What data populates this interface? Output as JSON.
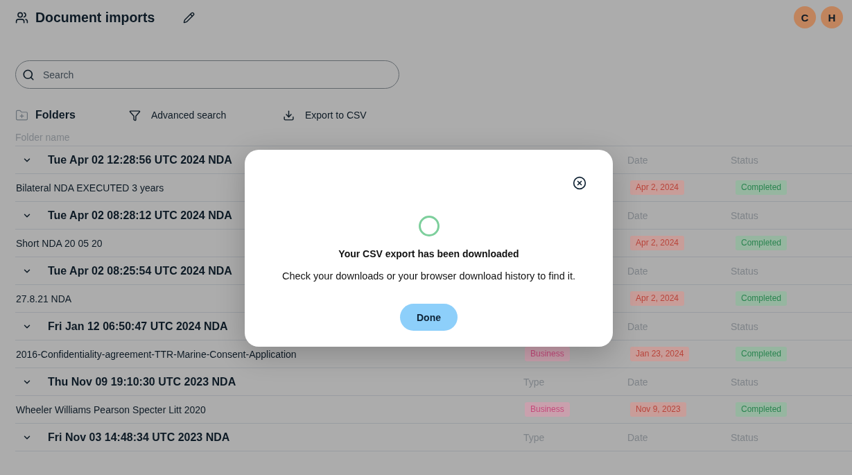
{
  "header": {
    "title": "Document imports",
    "avatars": [
      {
        "initial": "C"
      },
      {
        "initial": "H"
      }
    ]
  },
  "search": {
    "placeholder": "Search"
  },
  "toolbar": {
    "folders_label": "Folders",
    "actions": [
      {
        "kind": "filter",
        "label": "Advanced search"
      },
      {
        "kind": "export",
        "label": "Export to CSV"
      }
    ]
  },
  "list": {
    "column_header": "Folder name",
    "groups": [
      {
        "title": "Tue Apr 02 12:28:56 UTC 2024 NDA",
        "expanded": true,
        "column_labels": {
          "date": "Date",
          "status": "Status"
        },
        "items": [
          {
            "name": "Bilateral NDA EXECUTED 3 years",
            "date": "Apr 2, 2024",
            "status": "Completed"
          }
        ]
      },
      {
        "title": "Tue Apr 02 08:28:12 UTC 2024 NDA",
        "expanded": true,
        "column_labels": {
          "date": "Date",
          "status": "Status"
        },
        "items": [
          {
            "name": "Short NDA 20 05 20",
            "date": "Apr 2, 2024",
            "status": "Completed"
          }
        ]
      },
      {
        "title": "Tue Apr 02 08:25:54 UTC 2024 NDA",
        "expanded": true,
        "column_labels": {
          "date": "Date",
          "status": "Status"
        },
        "items": [
          {
            "name": "27.8.21 NDA",
            "date": "Apr 2, 2024",
            "status": "Completed"
          }
        ]
      },
      {
        "title": "Fri Jan 12 06:50:47 UTC 2024 NDA",
        "expanded": true,
        "column_labels": {
          "date": "Date",
          "status": "Status"
        },
        "items": [
          {
            "name": "2016-Confidentiality-agreement-TTR-Marine-Consent-Application",
            "type": "Business",
            "date": "Jan 23, 2024",
            "status": "Completed"
          }
        ]
      },
      {
        "title": "Thu Nov 09 19:10:30 UTC 2023 NDA",
        "expanded": true,
        "column_labels": {
          "type": "Type",
          "date": "Date",
          "status": "Status"
        },
        "items": [
          {
            "name": "Wheeler Williams Pearson Specter Litt 2020",
            "type": "Business",
            "date": "Nov 9, 2023",
            "status": "Completed"
          }
        ]
      },
      {
        "title": "Fri Nov 03 14:48:34 UTC 2023 NDA",
        "expanded": true,
        "column_labels": {
          "type": "Type",
          "date": "Date",
          "status": "Status"
        }
      }
    ]
  },
  "dialog": {
    "title": "Your CSV export has been downloaded",
    "message": "Check your downloads or your browser download history to find it.",
    "button": "Done"
  }
}
